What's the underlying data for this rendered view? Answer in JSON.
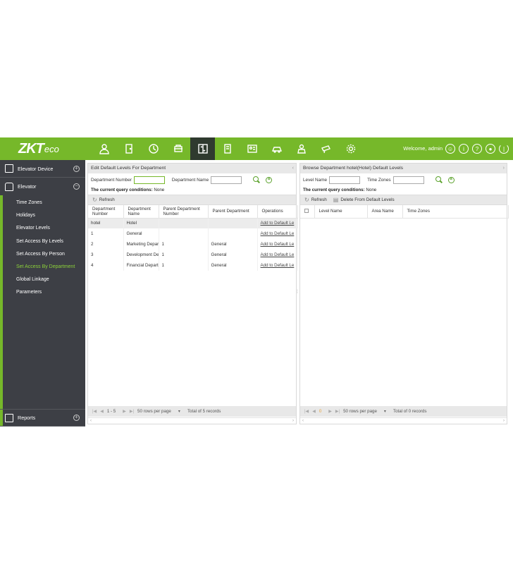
{
  "logo": {
    "main": "ZKT",
    "suffix": "eco"
  },
  "header": {
    "welcome": "Welcome, admin",
    "modules": [
      "personnel-icon",
      "door-icon",
      "time-icon",
      "access-icon",
      "elevator-icon",
      "visitor-icon",
      "id-card-icon",
      "parking-icon",
      "patrol-icon",
      "video-icon",
      "settings-icon"
    ]
  },
  "sidebar": {
    "device_label": "Elevator Device",
    "elevator_label": "Elevator",
    "items": [
      {
        "label": "Time Zones"
      },
      {
        "label": "Holidays"
      },
      {
        "label": "Elevator Levels"
      },
      {
        "label": "Set Access By Levels"
      },
      {
        "label": "Set Access By Person"
      },
      {
        "label": "Set Access By Department"
      },
      {
        "label": "Global Linkage"
      },
      {
        "label": "Parameters"
      }
    ],
    "reports_label": "Reports",
    "accent": "#76b82a"
  },
  "left_panel": {
    "title": "Edit Default Levels For Department",
    "field1_label": "Department Number",
    "field2_label": "Department Name",
    "conditions_label": "The current query conditions:",
    "conditions_value": "None",
    "refresh": "Refresh",
    "columns": [
      "Department Number",
      "Department Name",
      "Parent Department Number",
      "Parent Department",
      "Operations"
    ],
    "rows": [
      {
        "num": "hotel",
        "name": "Hotel",
        "pnum": "",
        "pname": "",
        "op": "Add to Default Le"
      },
      {
        "num": "1",
        "name": "General",
        "pnum": "",
        "pname": "",
        "op": "Add to Default Le"
      },
      {
        "num": "2",
        "name": "Marketing Departr",
        "pnum": "1",
        "pname": "General",
        "op": "Add to Default Le"
      },
      {
        "num": "3",
        "name": "Development Dep",
        "pnum": "1",
        "pname": "General",
        "op": "Add to Default Le"
      },
      {
        "num": "4",
        "name": "Financial Departm",
        "pnum": "1",
        "pname": "General",
        "op": "Add to Default Le"
      }
    ],
    "pager": {
      "range": "1 - 5",
      "rows_per_page": "50 rows per page",
      "total": "Total of 5 records"
    }
  },
  "right_panel": {
    "title": "Browse Department hotel(Hotel) Default Levels",
    "field1_label": "Level Name",
    "field2_label": "Time Zones",
    "conditions_label": "The current query conditions:",
    "conditions_value": "None",
    "refresh": "Refresh",
    "delete": "Delete From Default Levels",
    "columns": [
      "Level Name",
      "Area Name",
      "Time Zones"
    ],
    "pager": {
      "page": "0",
      "rows_per_page": "50 rows per page",
      "total": "Total of 0 records"
    }
  }
}
